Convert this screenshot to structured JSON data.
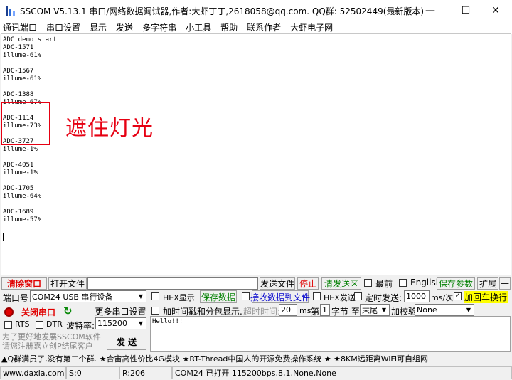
{
  "window": {
    "title": "SSCOM V5.13.1 串口/网络数据调试器,作者:大虾丁丁,2618058@qq.com. QQ群: 52502449(最新版本)",
    "minimize": "—",
    "maximize": "☐",
    "close": "✕"
  },
  "menu": [
    "通讯端口",
    "串口设置",
    "显示",
    "发送",
    "多字符串",
    "小工具",
    "帮助",
    "联系作者",
    "大虾电子网"
  ],
  "receive_text": "ADC demo start\nADC-1571\nillume-61%\n\nADC-1567\nillume-61%\n\nADC-1388\nillume-67%\n\nADC-1114\nillume-73%\n\nADC-3727\nillume-1%\n\nADC-4051\nillume-1%\n\nADC-1705\nillume-64%\n\nADC-1689\nillume-57%",
  "annotation": "遮住灯光",
  "toolbar": {
    "clear": "清除窗口",
    "open_file": "打开文件",
    "send_file": "发送文件",
    "stop": "停止",
    "clear_send": "清发送区",
    "front": "最前",
    "english": "English",
    "save_params": "保存参数",
    "expand": "扩展",
    "dash": "—"
  },
  "port": {
    "label": "端口号",
    "value": "COM24 USB 串行设备",
    "close_port": "关闭串口",
    "more_settings": "更多串口设置",
    "rts": "RTS",
    "dtr": "DTR",
    "baud_label": "波特率:",
    "baud": "115200"
  },
  "options": {
    "hex_show": "HEX显示",
    "save_data": "保存数据",
    "recv_to_file": "接收数据到文件",
    "hex_send": "HEX发送",
    "timed_send": "定时发送:",
    "interval": "1000",
    "interval_unit": "ms/次",
    "add_crlf": "加回车换行",
    "timestamp": "加时间戳和分包显示.",
    "timeout_label": "超时时间:",
    "timeout": "20",
    "timeout_unit": "ms",
    "page_label": "第",
    "page": "1",
    "byte_label": "字节 至",
    "end": "末尾",
    "checksum_label": "加校验",
    "checksum": "None"
  },
  "promo_left": "为了更好地发展SSCOM软件\n请您注册嘉立创P结尾客户",
  "send": {
    "button": "发 送",
    "text": "Hello!!!"
  },
  "promo": "▲Q群满员了,没有第二个群. ★合宙高性价比4G模块 ★RT-Thread中国人的开源免费操作系统 ★ ★8KM远距离WiFi可自组网",
  "status": {
    "site": "www.daxia.com",
    "s": "S:0",
    "r": "R:206",
    "port_status": "COM24 已打开  115200bps,8,1,None,None"
  }
}
